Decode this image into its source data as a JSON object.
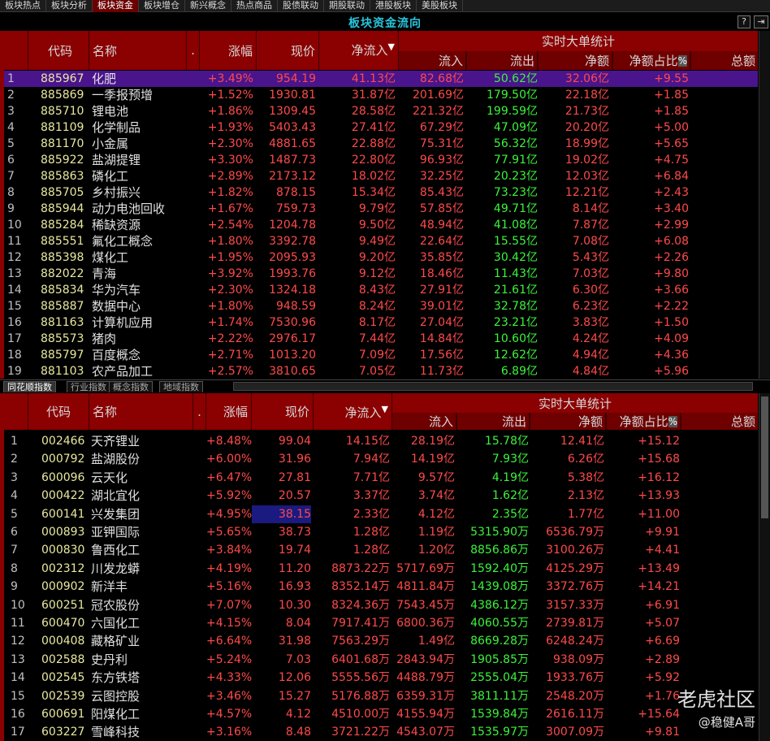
{
  "top_tabs": [
    {
      "label": "板块热点",
      "active": false
    },
    {
      "label": "板块分析",
      "active": false
    },
    {
      "label": "板块资金",
      "active": true
    },
    {
      "label": "板块增仓",
      "active": false
    },
    {
      "label": "新兴概念",
      "active": false
    },
    {
      "label": "热点商品",
      "active": false
    },
    {
      "label": "股债联动",
      "active": false
    },
    {
      "label": "期股联动",
      "active": false
    },
    {
      "label": "港股板块",
      "active": false
    },
    {
      "label": "美股板块",
      "active": false
    }
  ],
  "window": {
    "title": "板块资金流向",
    "help_label": "?",
    "exit_label": "⇥"
  },
  "headers": {
    "code": "代码",
    "name": "名称",
    "dot": ".",
    "change": "涨幅",
    "price": "现价",
    "net_inflow": "净流入",
    "sort_arrow": "▼",
    "group": "实时大单统计",
    "inflow": "流入",
    "outflow": "流出",
    "net": "净额",
    "net_ratio": "净额占比",
    "pct_mark": "%",
    "total": "总额"
  },
  "sectors": [
    [
      "1",
      "885967",
      "化肥",
      "+3.49%",
      "954.19",
      "41.13亿",
      "82.68亿",
      "50.62亿",
      "32.06亿",
      "+9.55"
    ],
    [
      "2",
      "885869",
      "一季报预增",
      "+1.52%",
      "1930.81",
      "31.87亿",
      "201.69亿",
      "179.50亿",
      "22.18亿",
      "+1.85"
    ],
    [
      "3",
      "885710",
      "锂电池",
      "+1.86%",
      "1309.45",
      "28.58亿",
      "221.32亿",
      "199.59亿",
      "21.73亿",
      "+1.85"
    ],
    [
      "4",
      "881109",
      "化学制品",
      "+1.93%",
      "5403.43",
      "27.41亿",
      "67.29亿",
      "47.09亿",
      "20.20亿",
      "+5.00"
    ],
    [
      "5",
      "881170",
      "小金属",
      "+2.30%",
      "4881.65",
      "22.88亿",
      "75.31亿",
      "56.32亿",
      "18.99亿",
      "+5.65"
    ],
    [
      "6",
      "885922",
      "盐湖提锂",
      "+3.30%",
      "1487.73",
      "22.80亿",
      "96.93亿",
      "77.91亿",
      "19.02亿",
      "+4.75"
    ],
    [
      "7",
      "885863",
      "磷化工",
      "+2.89%",
      "2173.12",
      "18.02亿",
      "32.25亿",
      "20.23亿",
      "12.03亿",
      "+6.84"
    ],
    [
      "8",
      "885705",
      "乡村振兴",
      "+1.82%",
      "878.15",
      "15.34亿",
      "85.43亿",
      "73.23亿",
      "12.21亿",
      "+2.43"
    ],
    [
      "9",
      "885944",
      "动力电池回收",
      "+1.67%",
      "759.73",
      "9.79亿",
      "57.85亿",
      "49.71亿",
      "8.14亿",
      "+3.40"
    ],
    [
      "10",
      "885284",
      "稀缺资源",
      "+2.54%",
      "1204.78",
      "9.50亿",
      "48.94亿",
      "41.08亿",
      "7.87亿",
      "+2.99"
    ],
    [
      "11",
      "885551",
      "氟化工概念",
      "+1.80%",
      "3392.78",
      "9.49亿",
      "22.64亿",
      "15.55亿",
      "7.08亿",
      "+6.08"
    ],
    [
      "12",
      "885398",
      "煤化工",
      "+1.95%",
      "2095.93",
      "9.20亿",
      "35.85亿",
      "30.42亿",
      "5.43亿",
      "+2.26"
    ],
    [
      "13",
      "882022",
      "青海",
      "+3.92%",
      "1993.76",
      "9.12亿",
      "18.46亿",
      "11.43亿",
      "7.03亿",
      "+9.80"
    ],
    [
      "14",
      "885834",
      "华为汽车",
      "+2.30%",
      "1324.18",
      "8.43亿",
      "27.91亿",
      "21.61亿",
      "6.30亿",
      "+3.66"
    ],
    [
      "15",
      "885887",
      "数据中心",
      "+1.80%",
      "948.59",
      "8.24亿",
      "39.01亿",
      "32.78亿",
      "6.23亿",
      "+2.22"
    ],
    [
      "16",
      "881163",
      "计算机应用",
      "+1.74%",
      "7530.96",
      "8.17亿",
      "27.04亿",
      "23.21亿",
      "3.83亿",
      "+1.50"
    ],
    [
      "17",
      "885573",
      "猪肉",
      "+2.22%",
      "2976.17",
      "7.44亿",
      "14.84亿",
      "10.60亿",
      "4.24亿",
      "+4.09"
    ],
    [
      "18",
      "885797",
      "百度概念",
      "+2.71%",
      "1013.20",
      "7.09亿",
      "17.56亿",
      "12.62亿",
      "4.94亿",
      "+4.36"
    ],
    [
      "19",
      "881103",
      "农产品加工",
      "+2.57%",
      "3810.65",
      "7.05亿",
      "11.73亿",
      "6.89亿",
      "4.84亿",
      "+5.96"
    ]
  ],
  "bottom_tabs": [
    {
      "label": "同花顺指数",
      "active": true
    },
    {
      "label": "行业指数",
      "active": false
    },
    {
      "label": "概念指数",
      "active": false
    },
    {
      "label": "地域指数",
      "active": false
    }
  ],
  "stocks": [
    [
      "1",
      "002466",
      "天齐锂业",
      "+8.48%",
      "99.04",
      "14.15亿",
      "28.19亿",
      "15.78亿",
      "12.41亿",
      "+15.12"
    ],
    [
      "2",
      "000792",
      "盐湖股份",
      "+6.00%",
      "31.96",
      "7.94亿",
      "14.19亿",
      "7.93亿",
      "6.26亿",
      "+15.68"
    ],
    [
      "3",
      "600096",
      "云天化",
      "+6.47%",
      "27.81",
      "7.71亿",
      "9.57亿",
      "4.19亿",
      "5.38亿",
      "+16.12"
    ],
    [
      "4",
      "000422",
      "湖北宜化",
      "+5.92%",
      "20.57",
      "3.37亿",
      "3.74亿",
      "1.62亿",
      "2.13亿",
      "+13.93"
    ],
    [
      "5",
      "600141",
      "兴发集团",
      "+4.95%",
      "38.15",
      "2.33亿",
      "4.12亿",
      "2.35亿",
      "1.77亿",
      "+11.00"
    ],
    [
      "6",
      "000893",
      "亚钾国际",
      "+5.65%",
      "38.73",
      "1.28亿",
      "1.19亿",
      "5315.90万",
      "6536.79万",
      "+9.91"
    ],
    [
      "7",
      "000830",
      "鲁西化工",
      "+3.84%",
      "19.74",
      "1.28亿",
      "1.20亿",
      "8856.86万",
      "3100.26万",
      "+4.41"
    ],
    [
      "8",
      "002312",
      "川发龙蟒",
      "+4.19%",
      "11.20",
      "8873.22万",
      "5717.69万",
      "1592.40万",
      "4125.29万",
      "+13.49"
    ],
    [
      "9",
      "000902",
      "新洋丰",
      "+5.16%",
      "16.93",
      "8352.14万",
      "4811.84万",
      "1439.08万",
      "3372.76万",
      "+14.21"
    ],
    [
      "10",
      "600251",
      "冠农股份",
      "+7.07%",
      "10.30",
      "8324.36万",
      "7543.45万",
      "4386.12万",
      "3157.33万",
      "+6.91"
    ],
    [
      "11",
      "600470",
      "六国化工",
      "+4.15%",
      "8.04",
      "7917.41万",
      "6800.36万",
      "4060.55万",
      "2739.81万",
      "+5.07"
    ],
    [
      "12",
      "000408",
      "藏格矿业",
      "+6.64%",
      "31.98",
      "7563.29万",
      "1.49亿",
      "8669.28万",
      "6248.24万",
      "+6.69"
    ],
    [
      "13",
      "002588",
      "史丹利",
      "+5.24%",
      "7.03",
      "6401.68万",
      "2843.94万",
      "1905.85万",
      "938.09万",
      "+2.89"
    ],
    [
      "14",
      "002545",
      "东方铁塔",
      "+4.33%",
      "12.06",
      "5555.56万",
      "4488.79万",
      "2555.04万",
      "1933.76万",
      "+5.92"
    ],
    [
      "15",
      "002539",
      "云图控股",
      "+3.46%",
      "15.27",
      "5176.88万",
      "6359.31万",
      "3811.11万",
      "2548.20万",
      "+1.76"
    ],
    [
      "16",
      "600691",
      "阳煤化工",
      "+4.57%",
      "4.12",
      "4510.00万",
      "4155.94万",
      "1539.84万",
      "2616.11万",
      "+15.64"
    ],
    [
      "17",
      "603227",
      "雪峰科技",
      "+3.16%",
      "8.48",
      "3721.22万",
      "4543.07万",
      "1535.97万",
      "3007.09万",
      "+9.81"
    ]
  ],
  "watermark": {
    "site": "老虎社区",
    "author": "@稳健A哥"
  }
}
